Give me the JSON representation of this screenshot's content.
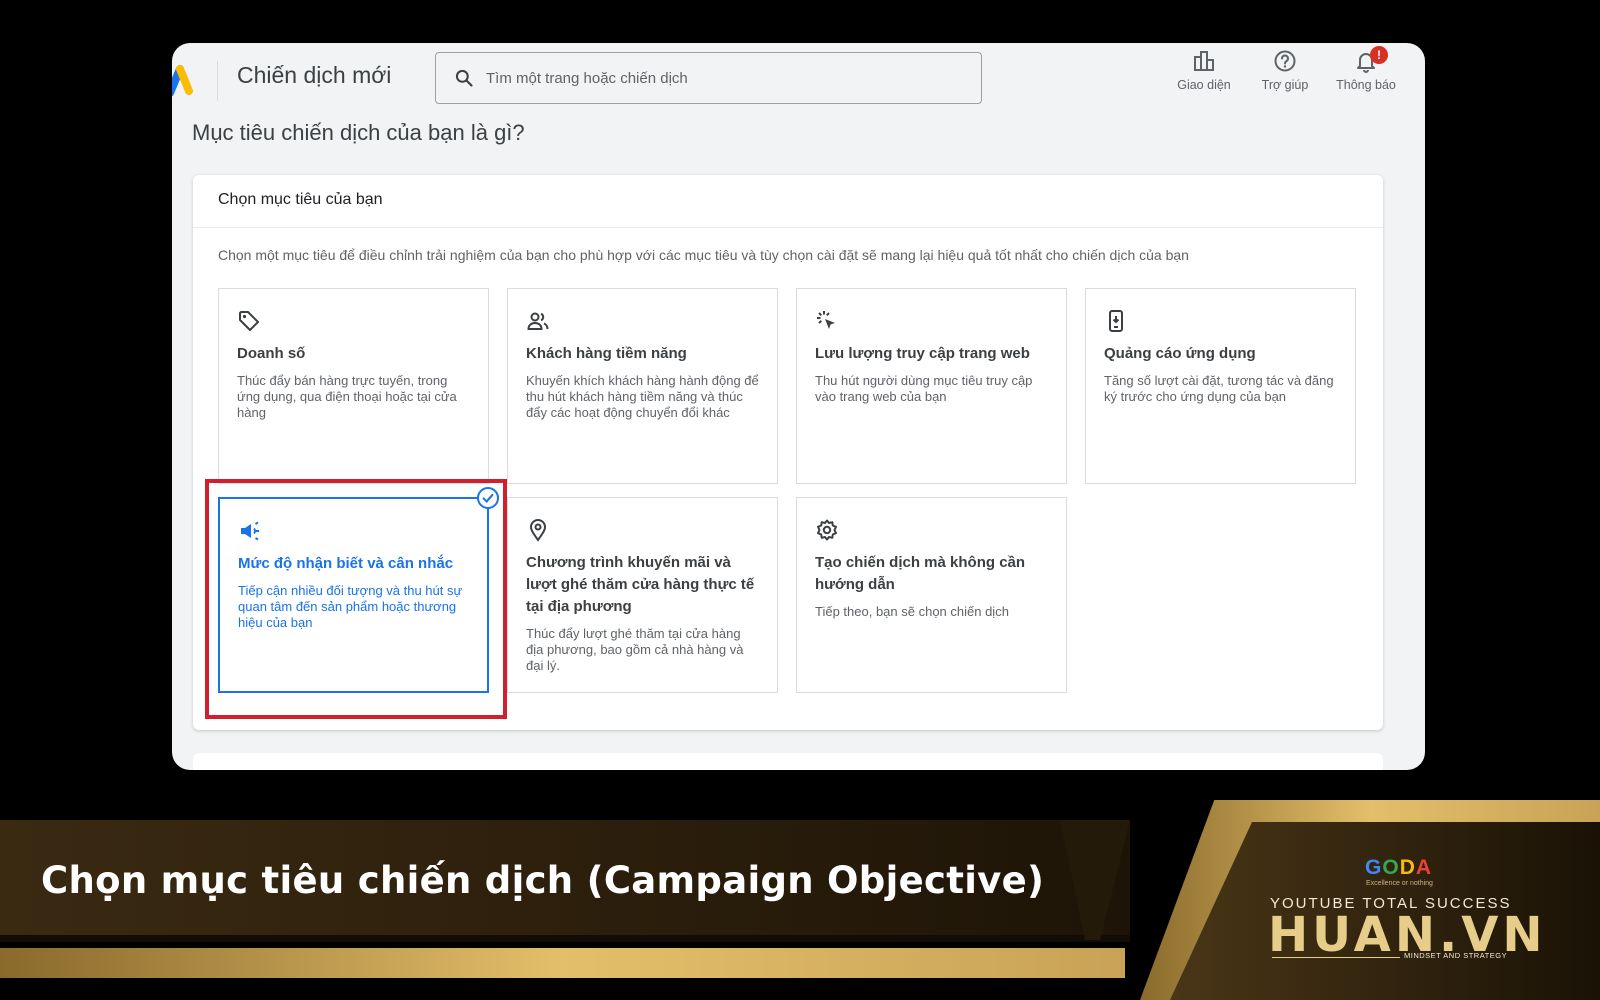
{
  "app": {
    "title": "Chiến dịch mới",
    "search_placeholder": "Tìm một trang hoặc chiến dịch",
    "actions": [
      {
        "label": "Giao diện",
        "icon": "appearance-icon"
      },
      {
        "label": "Trợ giúp",
        "icon": "help-icon"
      },
      {
        "label": "Thông báo",
        "icon": "bell-icon",
        "badge": "!"
      }
    ]
  },
  "page": {
    "heading": "Mục tiêu chiến dịch của bạn là gì?",
    "panel_title": "Chọn mục tiêu của bạn",
    "panel_description": "Chọn một mục tiêu để điều chỉnh trải nghiệm của bạn cho phù hợp với các mục tiêu và tùy chọn cài đặt sẽ mang lại hiệu quả tốt nhất cho chiến dịch của bạn"
  },
  "objectives": [
    {
      "title": "Doanh số",
      "description": "Thúc đẩy bán hàng trực tuyến, trong ứng dụng, qua điện thoại hoặc tại cửa hàng",
      "icon": "tag-icon",
      "selected": false
    },
    {
      "title": "Khách hàng tiềm năng",
      "description": "Khuyến khích khách hàng hành động để thu hút khách hàng tiềm năng và thúc đẩy các hoạt động chuyển đổi khác",
      "icon": "people-icon",
      "selected": false
    },
    {
      "title": "Lưu lượng truy cập trang web",
      "description": "Thu hút người dùng mục tiêu truy cập vào trang web của bạn",
      "icon": "click-icon",
      "selected": false
    },
    {
      "title": "Quảng cáo ứng dụng",
      "description": "Tăng số lượt cài đặt, tương tác và đăng ký trước cho ứng dụng của bạn",
      "icon": "phone-icon",
      "selected": false
    },
    {
      "title": "Mức độ nhận biết và cân nhắc",
      "description": "Tiếp cận nhiều đối tượng và thu hút sự quan tâm đến sản phẩm hoặc thương hiệu của bạn",
      "icon": "megaphone-icon",
      "selected": true
    },
    {
      "title": "Chương trình khuyến mãi và lượt ghé thăm cửa hàng thực tế tại địa phương",
      "description": "Thúc đẩy lượt ghé thăm tại cửa hàng địa phương, bao gồm cả nhà hàng và đại lý.",
      "icon": "location-pin-icon",
      "selected": false
    },
    {
      "title": "Tạo chiến dịch mà không cần hướng dẫn",
      "description": "Tiếp theo, bạn sẽ chọn chiến dịch",
      "icon": "gear-icon",
      "selected": false
    }
  ],
  "banner": {
    "title": "Chọn mục tiêu chiến dịch (Campaign Objective)",
    "logo_letters": [
      "G",
      "O",
      "D",
      "A"
    ],
    "logo_tagline": "Excellence or nothing",
    "brand_sub": "YOUTUBE TOTAL SUCCESS",
    "brand_main": "HUAN.VN",
    "brand_tagline": "MINDSET AND STRATEGY"
  },
  "colors": {
    "accent": "#1a73e8",
    "highlight": "#d0202d",
    "badge": "#d93025",
    "gold": "#e6cd8a"
  }
}
